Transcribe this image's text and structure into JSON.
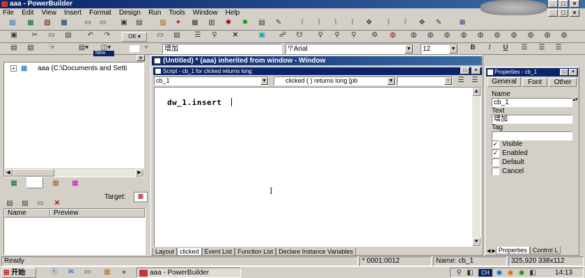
{
  "window": {
    "title": "aaa - PowerBuilder"
  },
  "menu": [
    "File",
    "Edit",
    "View",
    "Insert",
    "Format",
    "Design",
    "Run",
    "Tools",
    "Window",
    "Help"
  ],
  "format_bar": {
    "text_value": "增加",
    "font": "Arial",
    "font_size": "12",
    "bold": "B",
    "italic": "I",
    "underline": "U"
  },
  "library": {
    "tree_item": "aaa (C:\\Documents and Setti",
    "popup_label": "New"
  },
  "output": {
    "target_label": "Target:",
    "col_name": "Name",
    "col_preview": "Preview"
  },
  "editor": {
    "title": "(Untitled) * (aaa) inherited from window - Window",
    "script_title": "Script - cb_1 for clicked returns long",
    "object": "cb_1",
    "event": "clicked ( ) returns long [pb",
    "code": "dw_1.insert",
    "tabs": [
      "Layout",
      "clicked",
      "Event List",
      "Function List",
      "Declare Instance Variables"
    ]
  },
  "properties": {
    "title": "Properties - cb_1",
    "tabs": [
      "General",
      "Font",
      "Other"
    ],
    "name_label": "Name",
    "name_value": "cb_1",
    "text_label": "Text",
    "text_value": "增加",
    "tag_label": "Tag",
    "tag_value": "",
    "checks": [
      {
        "label": "Visible",
        "checked": true
      },
      {
        "label": "Enabled",
        "checked": true
      },
      {
        "label": "Default",
        "checked": false
      },
      {
        "label": "Cancel",
        "checked": false
      }
    ],
    "bottom_tabs": [
      "Properties",
      "Control L"
    ]
  },
  "status": {
    "ready": "Ready",
    "pos": "* 0001:0012",
    "name": "Name: cb_1",
    "coords": "325,920 338x112"
  },
  "taskbar": {
    "start": "开始",
    "task": "aaa - PowerBuilder",
    "ime": "CH",
    "clock": "14:13"
  }
}
